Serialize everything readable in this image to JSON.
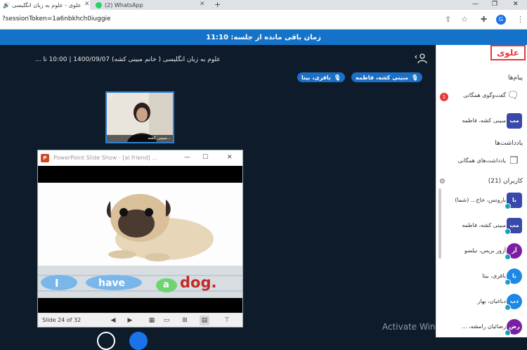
{
  "browser": {
    "tabs": [
      {
        "label": "علوی - علوم به زبان انگلیسی",
        "active": true
      },
      {
        "label": "(2) WhatsApp",
        "active": false
      }
    ],
    "url": "?sessionToken=1a6nbkhch0iuggie",
    "profile_initial": "G"
  },
  "session": {
    "timer_label": "زمان باقی مانده از جلسه: 11:10",
    "title": "علوم به زبان انگلیسی ( خانم مبینی کشه) 1400/09/07 | 10:00 تا ..."
  },
  "speakers": [
    {
      "name": "مبینی کشه، فاطمه"
    },
    {
      "name": "باقری، بیتا"
    }
  ],
  "webcam": {
    "name": "مبینی کشه..."
  },
  "ppt": {
    "title": "PowerPoint Slide Show - [ai friend] ...",
    "slide_counter": "Slide 24 of 32",
    "slide_words": [
      "I",
      "have",
      "a",
      "dog."
    ]
  },
  "sidebar": {
    "logo": "علوی",
    "messages_title": "پیام‌ها",
    "public_chat": "گفت‌وگوی همگانی",
    "unread_count": "1",
    "private_chat": {
      "initials": "مب",
      "name": "مبینی کشه، فاطمه"
    },
    "notes_title": "یادداشت‌ها",
    "public_notes": "یادداشت‌های همگانی",
    "users_title": "کاربران (21)",
    "users": [
      {
        "initials": "با",
        "name": "بارونس، خاج... (شما)",
        "color": "#3949ab"
      },
      {
        "initials": "مب",
        "name": "مبینی کشه، فاطمه",
        "color": "#3949ab"
      },
      {
        "initials": "آز",
        "name": "آزور بریس، نیلسو",
        "color": "#7b1fa2"
      },
      {
        "initials": "با",
        "name": "باقری، بیتا",
        "color": "#1e88e5"
      },
      {
        "initials": "دب",
        "name": "دباغیان، بهار",
        "color": "#1e88e5"
      },
      {
        "initials": "رض",
        "name": "رضائیان رامشه، ...",
        "color": "#7b1fa2"
      }
    ]
  },
  "watermark": {
    "line1": "Activate Windows"
  }
}
